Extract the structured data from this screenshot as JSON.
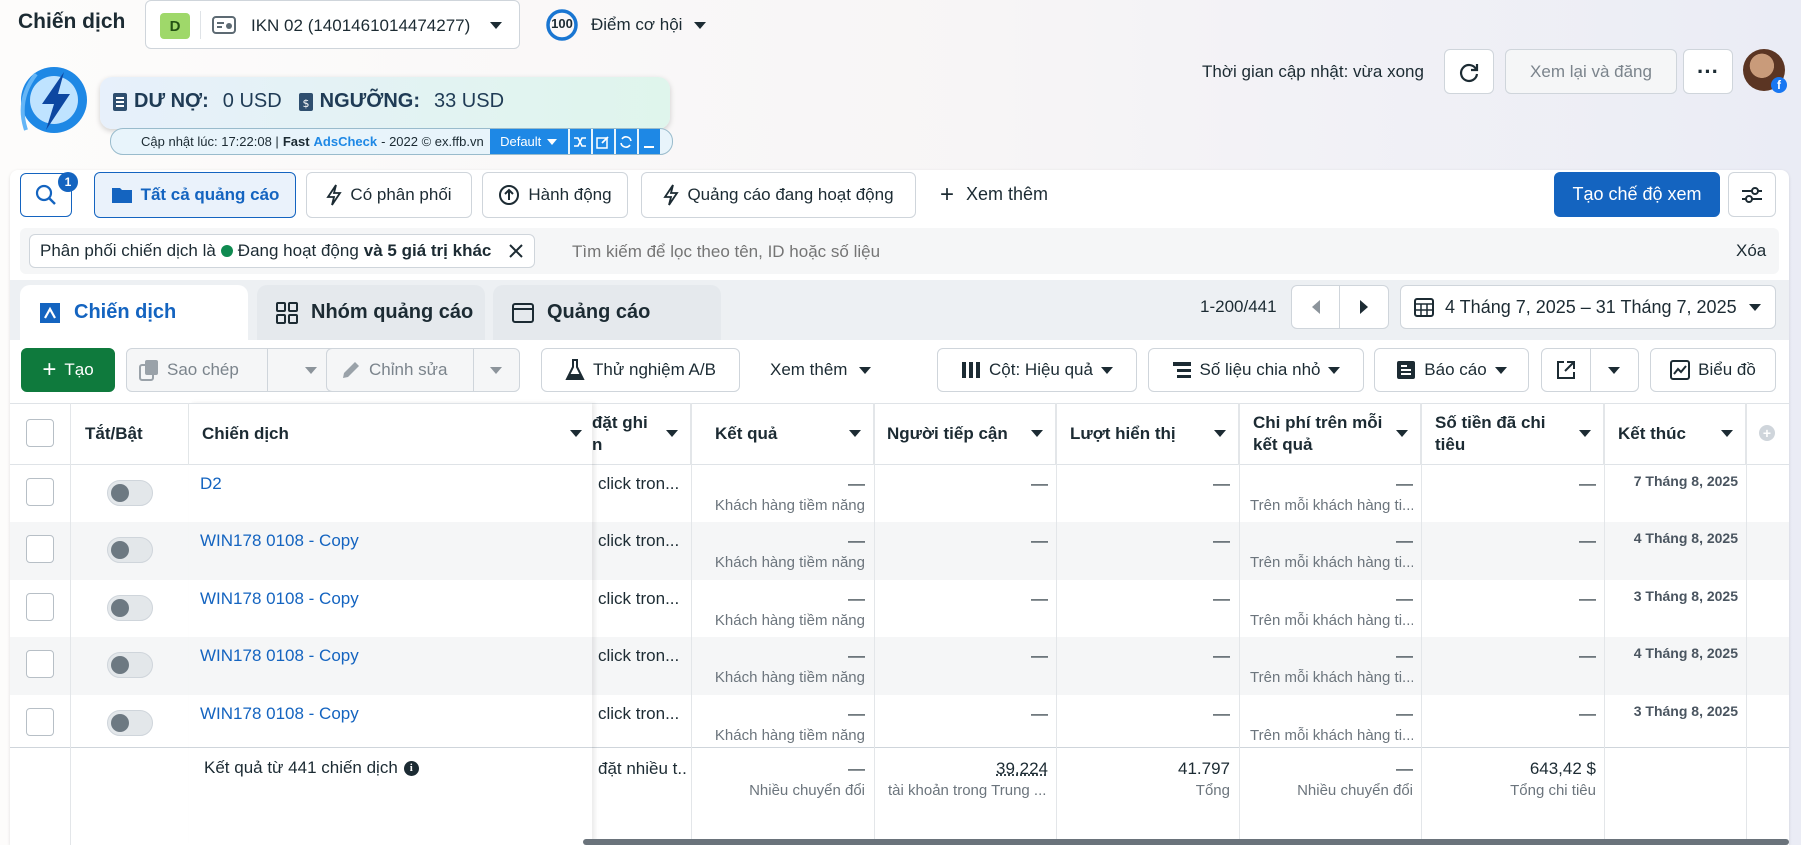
{
  "header": {
    "title": "Chiến dịch",
    "account_badge": "D",
    "account_name": "IKN 02 (1401461014474277)",
    "opportunity_score": "100",
    "opportunity_label": "Điểm cơ hội",
    "updated_text": "Thời gian cập nhật: vừa xong",
    "review_publish": "Xem lại và đăng"
  },
  "extension": {
    "debt_label": "DƯ NỢ:",
    "debt_value": "0 USD",
    "threshold_label": "NGƯỠNG:",
    "threshold_value": "33 USD",
    "update_prefix": "Cập nhật lúc: 17:22:08 |",
    "brand_fast": "Fast",
    "brand_ads": "AdsCheck",
    "brand_rest": "- 2022 © ex.ffb.vn",
    "dropdown": "Default"
  },
  "toolbar": {
    "search_badge": "1",
    "all_ads": "Tất cả quảng cáo",
    "delivering": "Có phân phối",
    "actions": "Hành động",
    "active_ads": "Quảng cáo đang hoạt động",
    "see_more": "Xem thêm",
    "create_view": "Tạo chế độ xem"
  },
  "filter": {
    "chip_prefix": "Phân phối chiến dịch là",
    "chip_status": "Đang hoạt động",
    "chip_more": "và 5 giá trị khác",
    "search_placeholder": "Tìm kiếm để lọc theo tên, ID hoặc số liệu",
    "clear": "Xóa"
  },
  "tabs": [
    {
      "label": "Chiến dịch"
    },
    {
      "label": "Nhóm quảng cáo"
    },
    {
      "label": "Quảng cáo"
    }
  ],
  "pagination": {
    "range": "1-200/441"
  },
  "date_range": "4 Tháng 7, 2025 – 31 Tháng 7, 2025",
  "actions": {
    "create": "Tạo",
    "copy": "Sao chép",
    "edit": "Chỉnh sửa",
    "ab_test": "Thử nghiệm A/B",
    "see_more": "Xem thêm",
    "columns": "Cột: Hiệu quả",
    "breakdown": "Số liệu chia nhỏ",
    "reports": "Báo cáo",
    "chart": "Biểu đồ"
  },
  "table": {
    "headers": {
      "toggle": "Tắt/Bật",
      "campaign": "Chiến dịch",
      "bid_line1": "đặt ghi",
      "bid_line2": "n",
      "results": "Kết quả",
      "reach": "Người tiếp cận",
      "impressions": "Lượt hiển thị",
      "cpr_line1": "Chi phí trên mỗi",
      "cpr_line2": "kết quả",
      "spent_line1": "Số tiền đã chi",
      "spent_line2": "tiêu",
      "end": "Kết thúc"
    },
    "rows": [
      {
        "name": "D2",
        "bid": "click tron...",
        "results": "—",
        "results_sub": "Khách hàng tiềm năng",
        "reach": "—",
        "impressions": "—",
        "cpr": "—",
        "cpr_sub": "Trên mỗi khách hàng ti...",
        "spent": "—",
        "end": "7 Tháng 8, 2025"
      },
      {
        "name": "WIN178 0108 - Copy",
        "bid": "click tron...",
        "results": "—",
        "results_sub": "Khách hàng tiềm năng",
        "reach": "—",
        "impressions": "—",
        "cpr": "—",
        "cpr_sub": "Trên mỗi khách hàng ti...",
        "spent": "—",
        "end": "4 Tháng 8, 2025"
      },
      {
        "name": "WIN178 0108 - Copy",
        "bid": "click tron...",
        "results": "—",
        "results_sub": "Khách hàng tiềm năng",
        "reach": "—",
        "impressions": "—",
        "cpr": "—",
        "cpr_sub": "Trên mỗi khách hàng ti...",
        "spent": "—",
        "end": "3 Tháng 8, 2025"
      },
      {
        "name": "WIN178 0108 - Copy",
        "bid": "click tron...",
        "results": "—",
        "results_sub": "Khách hàng tiềm năng",
        "reach": "—",
        "impressions": "—",
        "cpr": "—",
        "cpr_sub": "Trên mỗi khách hàng ti...",
        "spent": "—",
        "end": "4 Tháng 8, 2025"
      },
      {
        "name": "WIN178 0108 - Copy",
        "bid": "click tron...",
        "results": "—",
        "results_sub": "Khách hàng tiềm năng",
        "reach": "—",
        "impressions": "—",
        "cpr": "—",
        "cpr_sub": "Trên mỗi khách hàng ti...",
        "spent": "—",
        "end": "3 Tháng 8, 2025"
      }
    ],
    "summary": {
      "label": "Kết quả từ 441 chiến dịch",
      "bid": "đặt nhiều t...",
      "results": "—",
      "results_sub": "Nhiều chuyển đổi",
      "reach": "39.224",
      "reach_sub": "tài khoản trong Trung ...",
      "impressions": "41.797",
      "impressions_sub": "Tổng",
      "cpr": "—",
      "cpr_sub": "Nhiều chuyển đổi",
      "spent": "643,42 $",
      "spent_sub": "Tổng chi tiêu"
    }
  },
  "colors": {
    "primary": "#1464c0",
    "create_green": "#0f7a3d",
    "ext_blue": "#1e88e5"
  }
}
